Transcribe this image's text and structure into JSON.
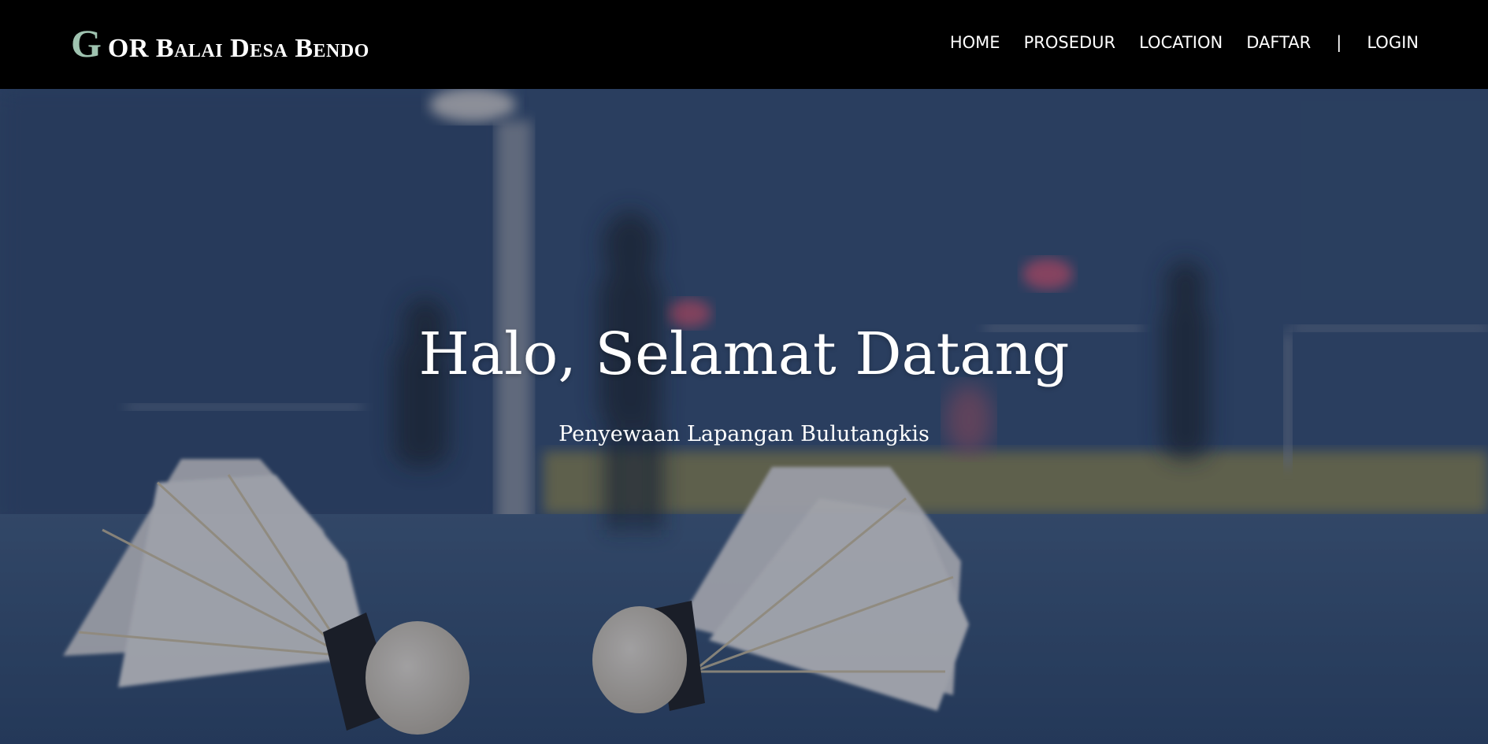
{
  "navbar": {
    "brand_initial": "G",
    "brand_rest": "OR Balai Desa Bendo",
    "links": [
      {
        "label": "HOME"
      },
      {
        "label": "PROSEDUR"
      },
      {
        "label": "LOCATION"
      },
      {
        "label": "DAFTAR"
      }
    ],
    "separator": "|",
    "login_label": "LOGIN"
  },
  "hero": {
    "title": "Halo, Selamat Datang",
    "subtitle": "Penyewaan Lapangan Bulutangkis"
  },
  "colors": {
    "navbar_bg": "#000000",
    "brand_accent": "#9fc3b0",
    "text": "#ffffff",
    "hero_tint": "#2f4a74"
  }
}
